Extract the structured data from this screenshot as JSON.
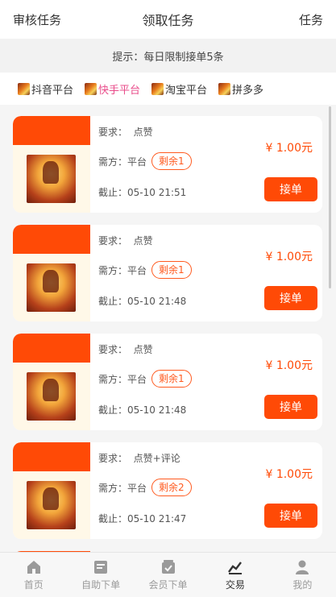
{
  "header": {
    "left": "审核任务",
    "title": "领取任务",
    "right": "任务"
  },
  "notice": "提示：每日限制接单5条",
  "platforms": [
    {
      "label": "抖音平台",
      "active": false
    },
    {
      "label": "快手平台",
      "active": true
    },
    {
      "label": "淘宝平台",
      "active": false
    },
    {
      "label": "拼多多",
      "active": false
    }
  ],
  "tasks": [
    {
      "require_label": "要求：",
      "require": "点赞",
      "payer_label": "需方：",
      "payer": "平台",
      "remain": "剩余1",
      "deadline_label": "截止：",
      "deadline": "05-10 21:51",
      "price": "¥ 1.00元",
      "action": "接单"
    },
    {
      "require_label": "要求：",
      "require": "点赞",
      "payer_label": "需方：",
      "payer": "平台",
      "remain": "剩余1",
      "deadline_label": "截止：",
      "deadline": "05-10 21:48",
      "price": "¥ 1.00元",
      "action": "接单"
    },
    {
      "require_label": "要求：",
      "require": "点赞",
      "payer_label": "需方：",
      "payer": "平台",
      "remain": "剩余1",
      "deadline_label": "截止：",
      "deadline": "05-10 21:48",
      "price": "¥ 1.00元",
      "action": "接单"
    },
    {
      "require_label": "要求：",
      "require": "点赞+评论",
      "payer_label": "需方：",
      "payer": "平台",
      "remain": "剩余2",
      "deadline_label": "截止：",
      "deadline": "05-10 21:47",
      "price": "¥ 1.00元",
      "action": "接单"
    }
  ],
  "tabs": [
    {
      "label": "首页",
      "icon": "home-icon",
      "active": false
    },
    {
      "label": "自助下单",
      "icon": "order-icon",
      "active": false
    },
    {
      "label": "会员下单",
      "icon": "member-order-icon",
      "active": false
    },
    {
      "label": "交易",
      "icon": "trade-icon",
      "active": true
    },
    {
      "label": "我的",
      "icon": "user-icon",
      "active": false
    }
  ],
  "colors": {
    "accent": "#ff4a06",
    "active_platform": "#e94d8b"
  }
}
